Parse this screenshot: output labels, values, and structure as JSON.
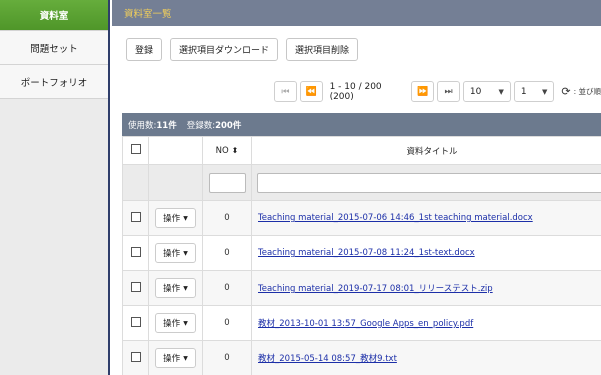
{
  "sidebar": {
    "items": [
      {
        "label": "資料室"
      },
      {
        "label": "問題セット"
      },
      {
        "label": "ポートフォリオ"
      }
    ]
  },
  "header": {
    "title": "資料室一覧"
  },
  "toolbar": {
    "register": "登録",
    "download_selected": "選択項目ダウンロード",
    "delete_selected": "選択項目削除"
  },
  "pager": {
    "info": "1 - 10 / 200 (200)",
    "page_size": "10",
    "page": "1",
    "refresh_text": ": 並び順"
  },
  "stats": {
    "used_label": "使用数:",
    "used_value": "11件",
    "reg_label": "登録数:",
    "reg_value": "200件"
  },
  "table": {
    "col_no": "NO",
    "col_title": "資料タイトル",
    "op_label": "操作",
    "rows": [
      {
        "no": "0",
        "title": "Teaching material_2015-07-06 14:46_1st teaching material.docx"
      },
      {
        "no": "0",
        "title": "Teaching material_2015-07-08 11:24_1st-text.docx"
      },
      {
        "no": "0",
        "title": "Teaching material_2019-07-17 08:01_リリーステスト.zip"
      },
      {
        "no": "0",
        "title": "教材_2013-10-01 13:57_Google Apps_en_policy.pdf"
      },
      {
        "no": "0",
        "title": "教材_2015-05-14 08:57_教材9.txt"
      }
    ]
  },
  "colors": {
    "sidebar_active": "#5ba233",
    "topbar": "#747f95",
    "topbar_text": "#f2cf5a",
    "statbar": "#6c7a8e",
    "link": "#1c2fa8"
  }
}
